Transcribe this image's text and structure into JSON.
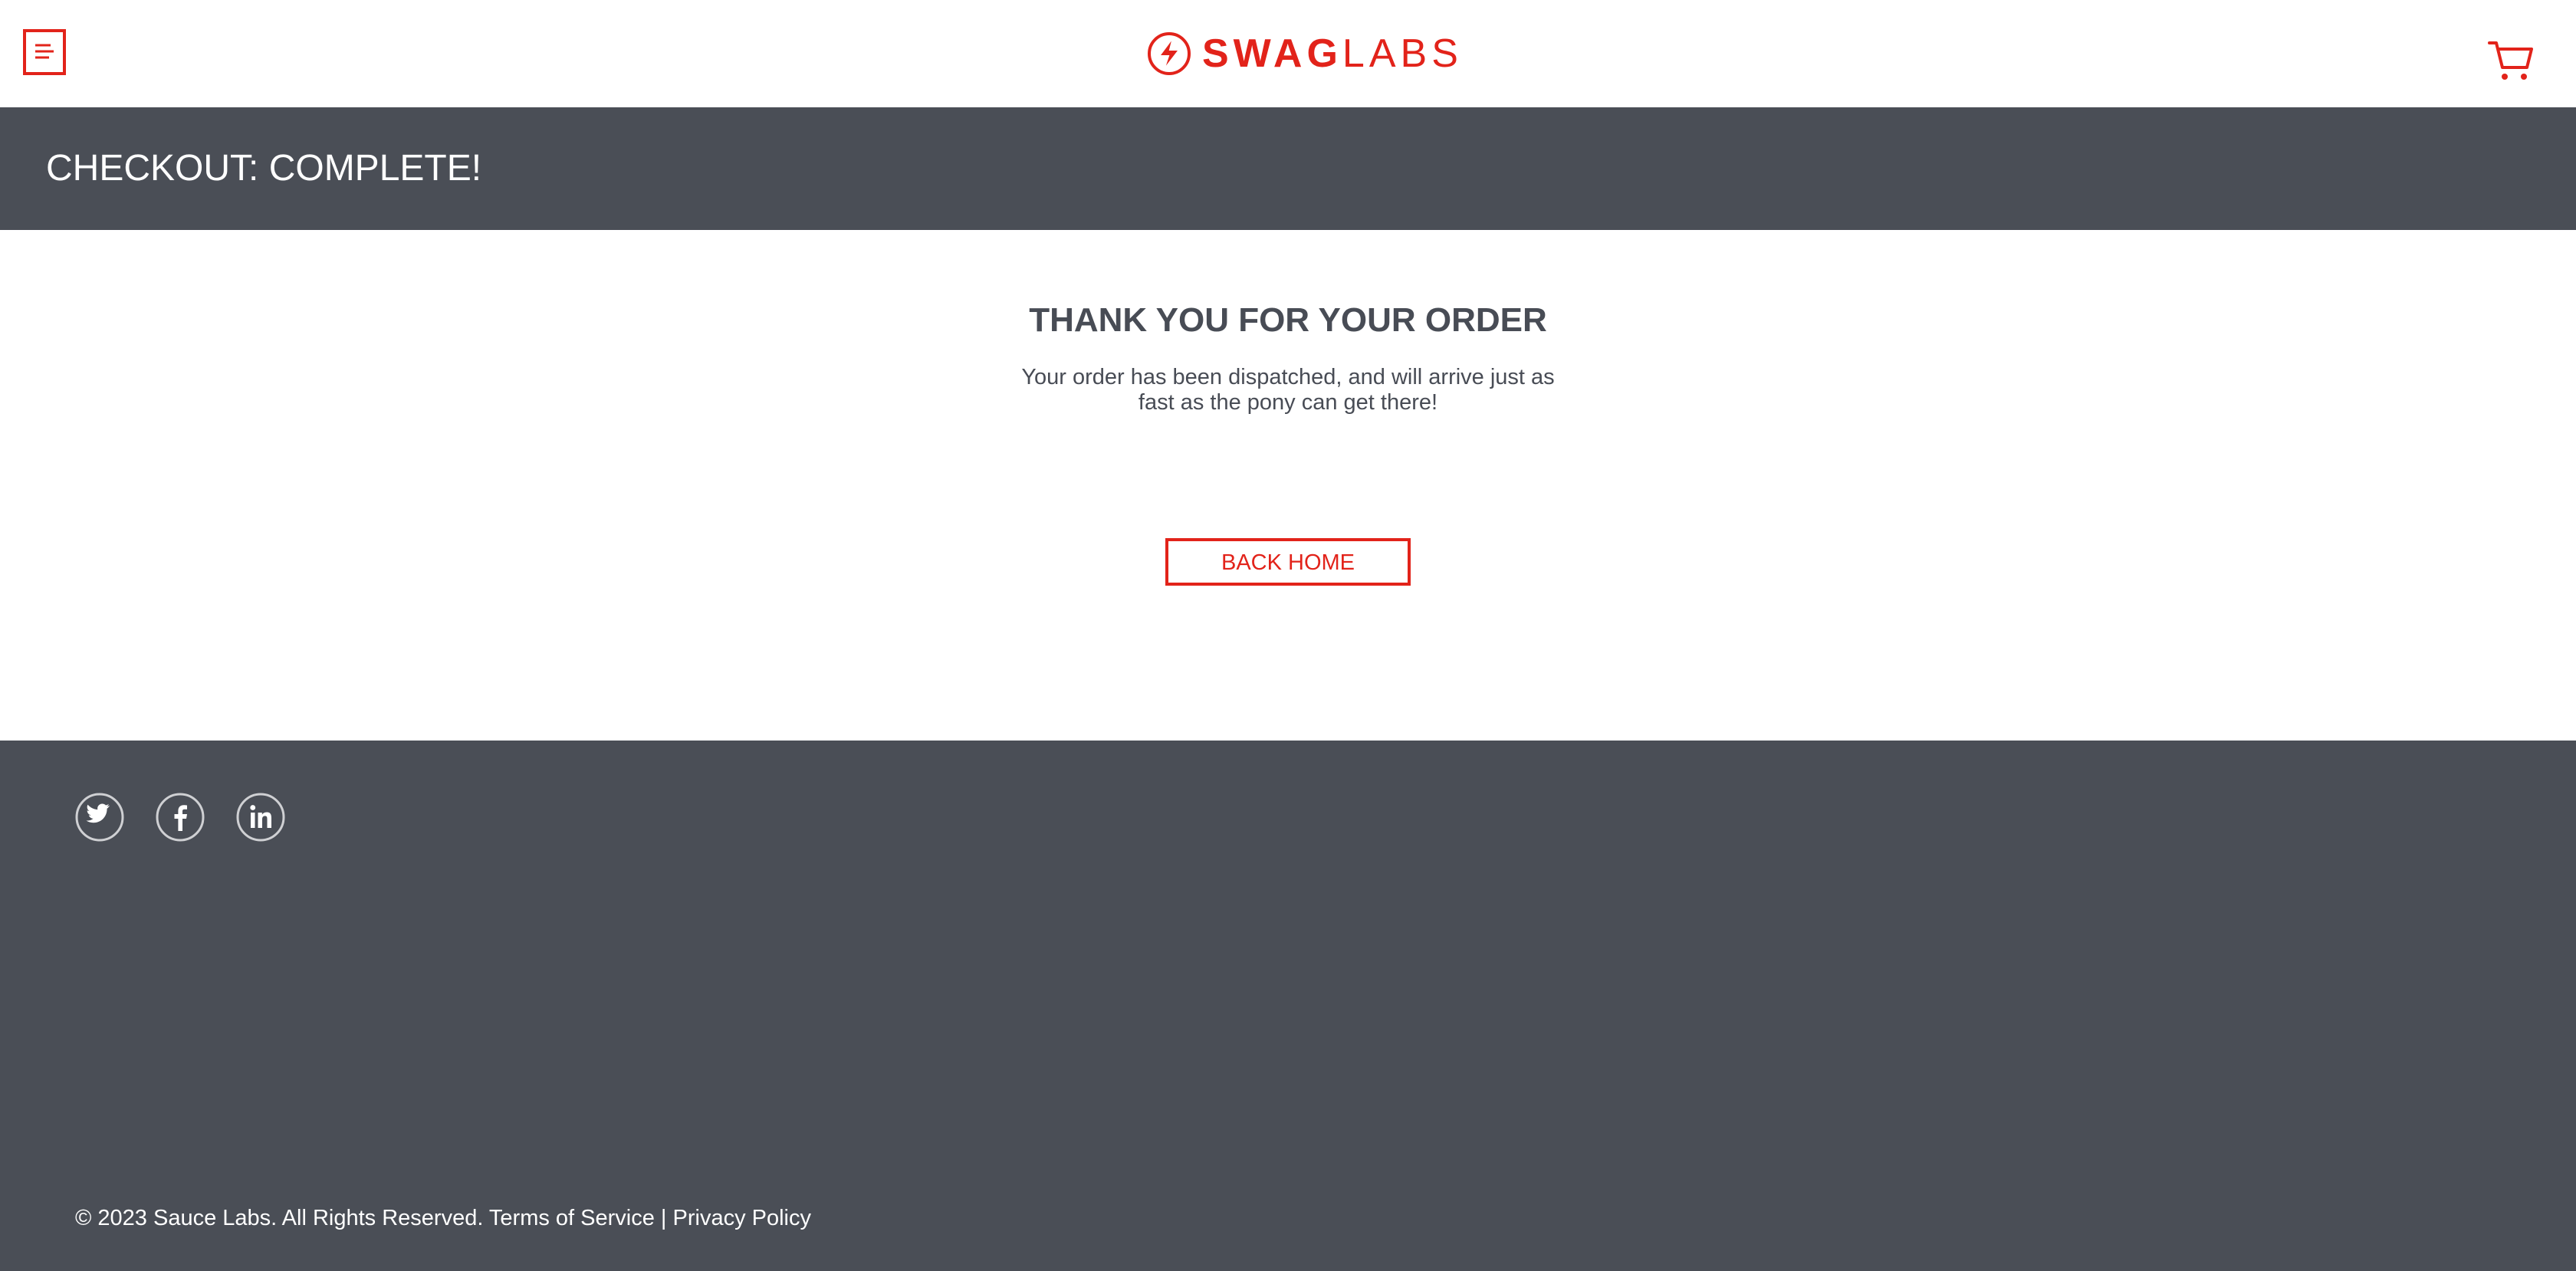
{
  "header": {
    "menu_icon": "hamburger-menu-icon",
    "logo": {
      "bold": "SWAG",
      "light": "LABS",
      "icon": "lightning-bolt-logo-icon"
    },
    "cart_icon": "shopping-cart-icon"
  },
  "subheader": {
    "title": "CHECKOUT: COMPLETE!"
  },
  "main": {
    "heading": "THANK YOU FOR YOUR ORDER",
    "message": "Your order has been dispatched, and will arrive just as fast as the pony can get there!",
    "back_home_label": "BACK HOME"
  },
  "footer": {
    "social_icons": [
      "twitter-icon",
      "facebook-icon",
      "linkedin-icon"
    ],
    "copyright": "© 2023 Sauce Labs. All Rights Reserved. Terms of Service | Privacy Policy"
  },
  "colors": {
    "accent": "#e2231a",
    "dark_bar": "#4a4e56",
    "text_dark": "#484c55",
    "white": "#ffffff"
  }
}
